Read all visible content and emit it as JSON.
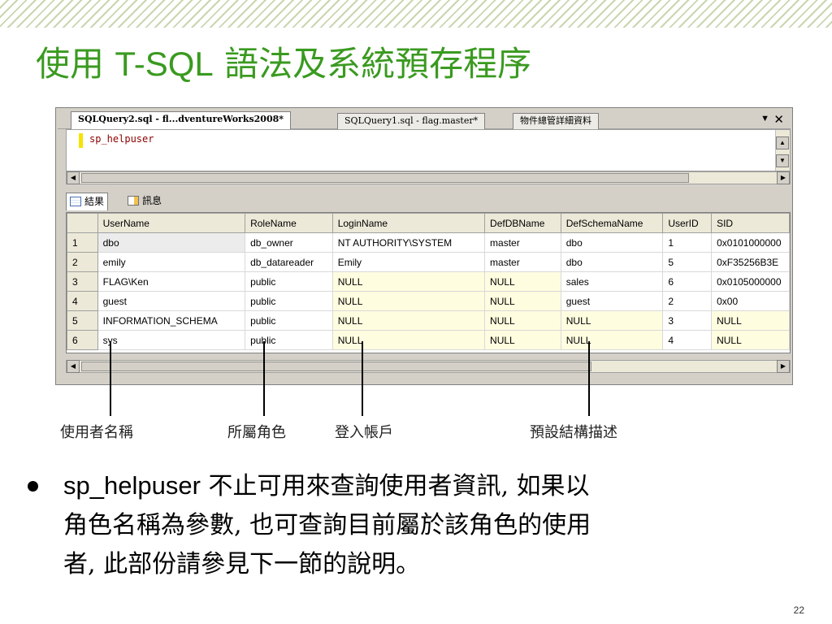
{
  "slide": {
    "title_latin": "T-SQL",
    "title_prefix": "使用",
    "title_suffix": "語法及系統預存程序",
    "page_number": "22"
  },
  "colors": {
    "title": "#3a9a20",
    "null_cell": "#fffde0",
    "code_text": "#8b0000"
  },
  "ssms": {
    "tabs": [
      {
        "label": "SQLQuery2.sql - fl...dventureWorks2008*"
      },
      {
        "label": "SQLQuery1.sql - flag.master*"
      },
      {
        "label": "物件總管詳細資料"
      }
    ],
    "dropdown_icon": "▼",
    "close_icon": "✕",
    "editor": {
      "code": "sp_helpuser"
    },
    "result_tabs": [
      {
        "label": "結果",
        "icon": "grid-icon"
      },
      {
        "label": "訊息",
        "icon": "message-icon"
      }
    ],
    "grid": {
      "columns": [
        "UserName",
        "RoleName",
        "LoginName",
        "DefDBName",
        "DefSchemaName",
        "UserID",
        "SID"
      ],
      "rows": [
        {
          "num": "1",
          "cells": [
            "dbo",
            "db_owner",
            "NT AUTHORITY\\SYSTEM",
            "master",
            "dbo",
            "1",
            "0x0101000000"
          ]
        },
        {
          "num": "2",
          "cells": [
            "emily",
            "db_datareader",
            "Emily",
            "master",
            "dbo",
            "5",
            "0xF35256B3E"
          ]
        },
        {
          "num": "3",
          "cells": [
            "FLAG\\Ken",
            "public",
            "NULL",
            "NULL",
            "sales",
            "6",
            "0x0105000000"
          ]
        },
        {
          "num": "4",
          "cells": [
            "guest",
            "public",
            "NULL",
            "NULL",
            "guest",
            "2",
            "0x00"
          ]
        },
        {
          "num": "5",
          "cells": [
            "INFORMATION_SCHEMA",
            "public",
            "NULL",
            "NULL",
            "NULL",
            "3",
            "NULL"
          ]
        },
        {
          "num": "6",
          "cells": [
            "sys",
            "public",
            "NULL",
            "NULL",
            "NULL",
            "4",
            "NULL"
          ]
        }
      ]
    }
  },
  "callouts": [
    "使用者名稱",
    "所屬角色",
    "登入帳戶",
    "預設結構描述"
  ],
  "bullet": {
    "lead": "sp_helpuser",
    "rest_line1": " 不止可用來查詢使用者資訊, 如果以",
    "line2": "角色名稱為參數, 也可查詢目前屬於該角色的使用",
    "line3": "者, 此部份請參見下一節的說明。"
  }
}
